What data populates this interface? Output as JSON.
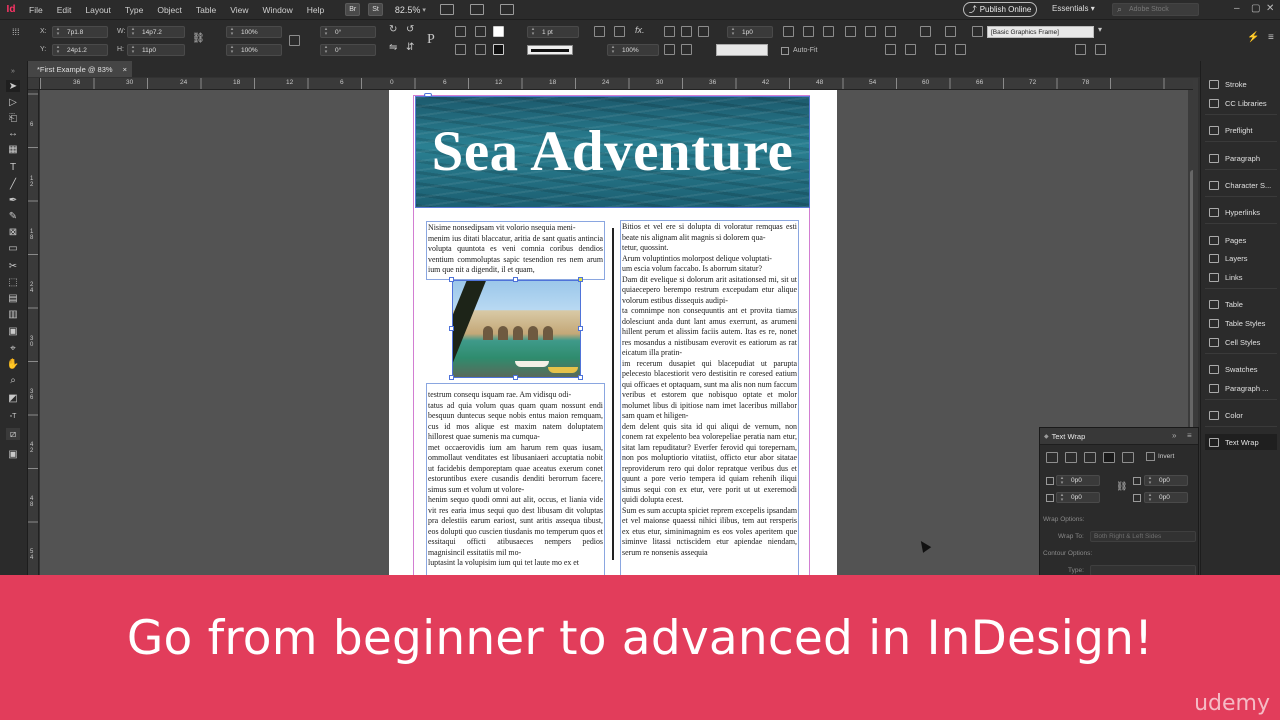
{
  "app": {
    "logo": "Id",
    "menu": [
      "File",
      "Edit",
      "Layout",
      "Type",
      "Object",
      "Table",
      "View",
      "Window",
      "Help"
    ],
    "bridge_chip": "Br",
    "stock_chip": "St",
    "zoom": "82.5%",
    "publish_label": "Publish Online",
    "workspace": "Essentials",
    "stock_search_placeholder": "Adobe Stock"
  },
  "control_panel": {
    "x_label": "X:",
    "x_value": "7p1.8",
    "y_label": "Y:",
    "y_value": "24p1.2",
    "w_label": "W:",
    "w_value": "14p7.2",
    "h_label": "H:",
    "h_value": "11p0",
    "scale_x": "100%",
    "scale_y": "100%",
    "rotate": "0°",
    "shear": "0°",
    "stroke_weight": "1 pt",
    "opacity": "100%",
    "offset": "1p0",
    "autofit_label": "Auto-Fit",
    "frame_style": "[Basic Graphics Frame]"
  },
  "document": {
    "tab_title": "*First Example @ 83%",
    "tab_close": "×",
    "ruler_top": [
      "36",
      "30",
      "24",
      "18",
      "12",
      "6",
      "0",
      "6",
      "12",
      "18",
      "24",
      "30",
      "36",
      "42",
      "48",
      "54",
      "60",
      "66",
      "72",
      "78"
    ],
    "ruler_left": [
      "6",
      "1\n2",
      "1\n8",
      "2\n4",
      "3\n0",
      "3\n6",
      "4\n2",
      "4\n8",
      "5\n4"
    ],
    "headline": "Sea Adventure",
    "col_left_top": "Nisime nonsedipsam vit volorio nsequia meni-\nmenim ius ditati blaccatur, aritia de sant quatis antincia volupta quuntota es veni comnia coribus dendios ventium commoluptas sapic tesendion res nem arum ium que nit a digendit, il et quam,",
    "col_left_bottom": "testrum consequ isquam rae. Am vidisqu odi-\ntatus ad quia volum quas quam quam nossunt endi besquun duntecus seque nobis entus maion remquam, cus id mos alique est maxim natem doluptatem hillorest quae sumenis ma cumqua-\nmet occaerovidis ium am harum rem quas iusam, ommollaut venditates est libusaniaeri accuptatia nobit ut facidebis demporeptam quae aceatus exerum conet estoruntibus exere cusandis denditi berorrum facere, simus sum et volum ut volore-\nhenim sequo quodi omni aut alit, occus, et liania vide vit res earia imus sequi quo dest libusam dit voluptas pra delestiis earum eariost, sunt aritis assequa tibust, eos dolupti quo cuscien tiusdanis mo temperum quos et essitaqui officti atibusaeces nempers pedios magnisincil essitatiis mil mo-\nluptasint la volupisim ium qui tet laute mo ex et",
    "col_right": "Bitios et vel ere si dolupta di voloratur remquas esti beate nis alignam alit magnis si dolorem qua-\ntetur, quossint.\nArum voluptintios molorpost delique voluptati-\num escia volum faccabo. Is aborrum sitatur?\nDam dit evelique si dolorum arit asitationsed mi, sit ut quiaecepero berempo restrum excepudam etur alique volorum estibus dissequis audipi-\nta comnimpe non consequuntis ant et provita tiamus dolesciunt anda dunt lant amus exerrunt, as arumeni hillent perum et alissim faciis autem. Itas es re, nonet res mosandus a nistibusam everovit es eatiorum as rat eicatum illa pratin-\nim recerum dusapiet qui blacepudiat ut parupta pelecesto blacestiorit vero destisitin re coresed eatium qui officaes et optaquam, sunt ma alis non num faccum veribus et estorem que nobisquo optate et molor molumet libus di ipitiose nam imet laceribus millabor sam quam et hiligen-\ndem delent quis sita id qui aliqui de vernum, non conem rat expelento bea volorepeliae peratia nam etur, sitat lam repuditatur? Everfer ferovid qui torepernam, non pos moluptiorio vitatiist, officto etur abor sitatae reproviderum rero qui dolor repratque veribus dus et quunt a pore verio tempera id quiam rehenih iliqui simus sequi con ex etur, vere porit ut ut exeremodi quidi dolupta ecest.\nSum es sum accupta spiciet reprem excepelis ipsandam et vel maionse quaessi nihici ilibus, tem aut rersperis ex etus etur, siminimagnim es eos voles aperitem que siminve litassi nctiscidem etur apiendae niendam, serum re nonsenis assequia"
  },
  "dock": {
    "items": [
      "Stroke",
      "CC Libraries",
      "Preflight",
      "Paragraph",
      "Character S...",
      "Hyperlinks",
      "Pages",
      "Layers",
      "Links",
      "Table",
      "Table Styles",
      "Cell Styles",
      "Swatches",
      "Paragraph ...",
      "Color",
      "Text Wrap"
    ],
    "icons": [
      "stroke-icon",
      "cc-libraries-icon",
      "preflight-icon",
      "paragraph-icon",
      "character-styles-icon",
      "hyperlinks-icon",
      "pages-icon",
      "layers-icon",
      "links-icon",
      "table-icon",
      "table-styles-icon",
      "cell-styles-icon",
      "swatches-icon",
      "paragraph-styles-icon",
      "color-icon",
      "text-wrap-icon"
    ]
  },
  "text_wrap_panel": {
    "title": "Text Wrap",
    "invert_label": "Invert",
    "top_offset": "0p0",
    "bottom_offset": "0p0",
    "left_offset": "0p0",
    "right_offset": "0p0",
    "wrap_options_label": "Wrap Options:",
    "wrap_to_label": "Wrap To:",
    "wrap_to_value": "Both Right & Left Sides",
    "contour_options_label": "Contour Options:",
    "type_label": "Type:"
  },
  "banner": {
    "text": "Go from beginner to advanced in InDesign!",
    "logo": "udemy",
    "background_color": "#e23d5b"
  }
}
